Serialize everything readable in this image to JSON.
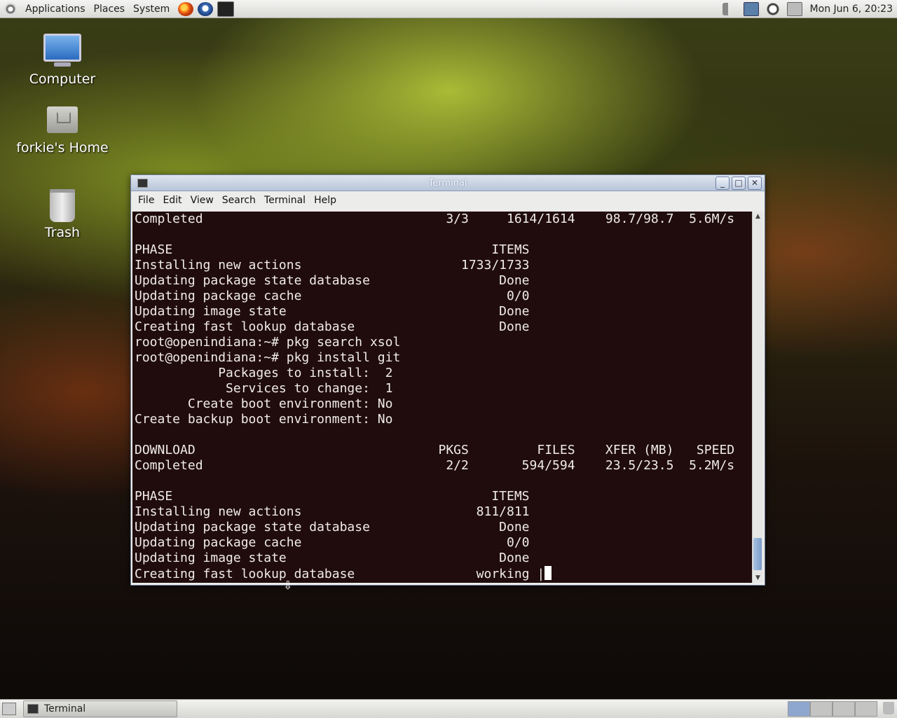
{
  "top_panel": {
    "menus": [
      "Applications",
      "Places",
      "System"
    ],
    "clock": "Mon Jun  6, 20:23"
  },
  "desktop_icons": [
    {
      "label": "Computer"
    },
    {
      "label": "forkie's Home"
    },
    {
      "label": "Trash"
    }
  ],
  "terminal": {
    "title": "Terminal",
    "menu": [
      "File",
      "Edit",
      "View",
      "Search",
      "Terminal",
      "Help"
    ],
    "lines": [
      "Completed                                3/3     1614/1614    98.7/98.7  5.6M/s",
      "",
      "PHASE                                          ITEMS",
      "Installing new actions                     1733/1733",
      "Updating package state database                 Done",
      "Updating package cache                           0/0",
      "Updating image state                            Done",
      "Creating fast lookup database                   Done",
      "root@openindiana:~# pkg search xsol",
      "root@openindiana:~# pkg install git",
      "           Packages to install:  2",
      "            Services to change:  1",
      "       Create boot environment: No",
      "Create backup boot environment: No",
      "",
      "DOWNLOAD                                PKGS         FILES    XFER (MB)   SPEED",
      "Completed                                2/2       594/594    23.5/23.5  5.2M/s",
      "",
      "PHASE                                          ITEMS",
      "Installing new actions                       811/811",
      "Updating package state database                 Done",
      "Updating package cache                           0/0",
      "Updating image state                            Done",
      "Creating fast lookup database                working |"
    ]
  },
  "taskbar": {
    "tasks": [
      {
        "label": "Terminal"
      }
    ]
  }
}
